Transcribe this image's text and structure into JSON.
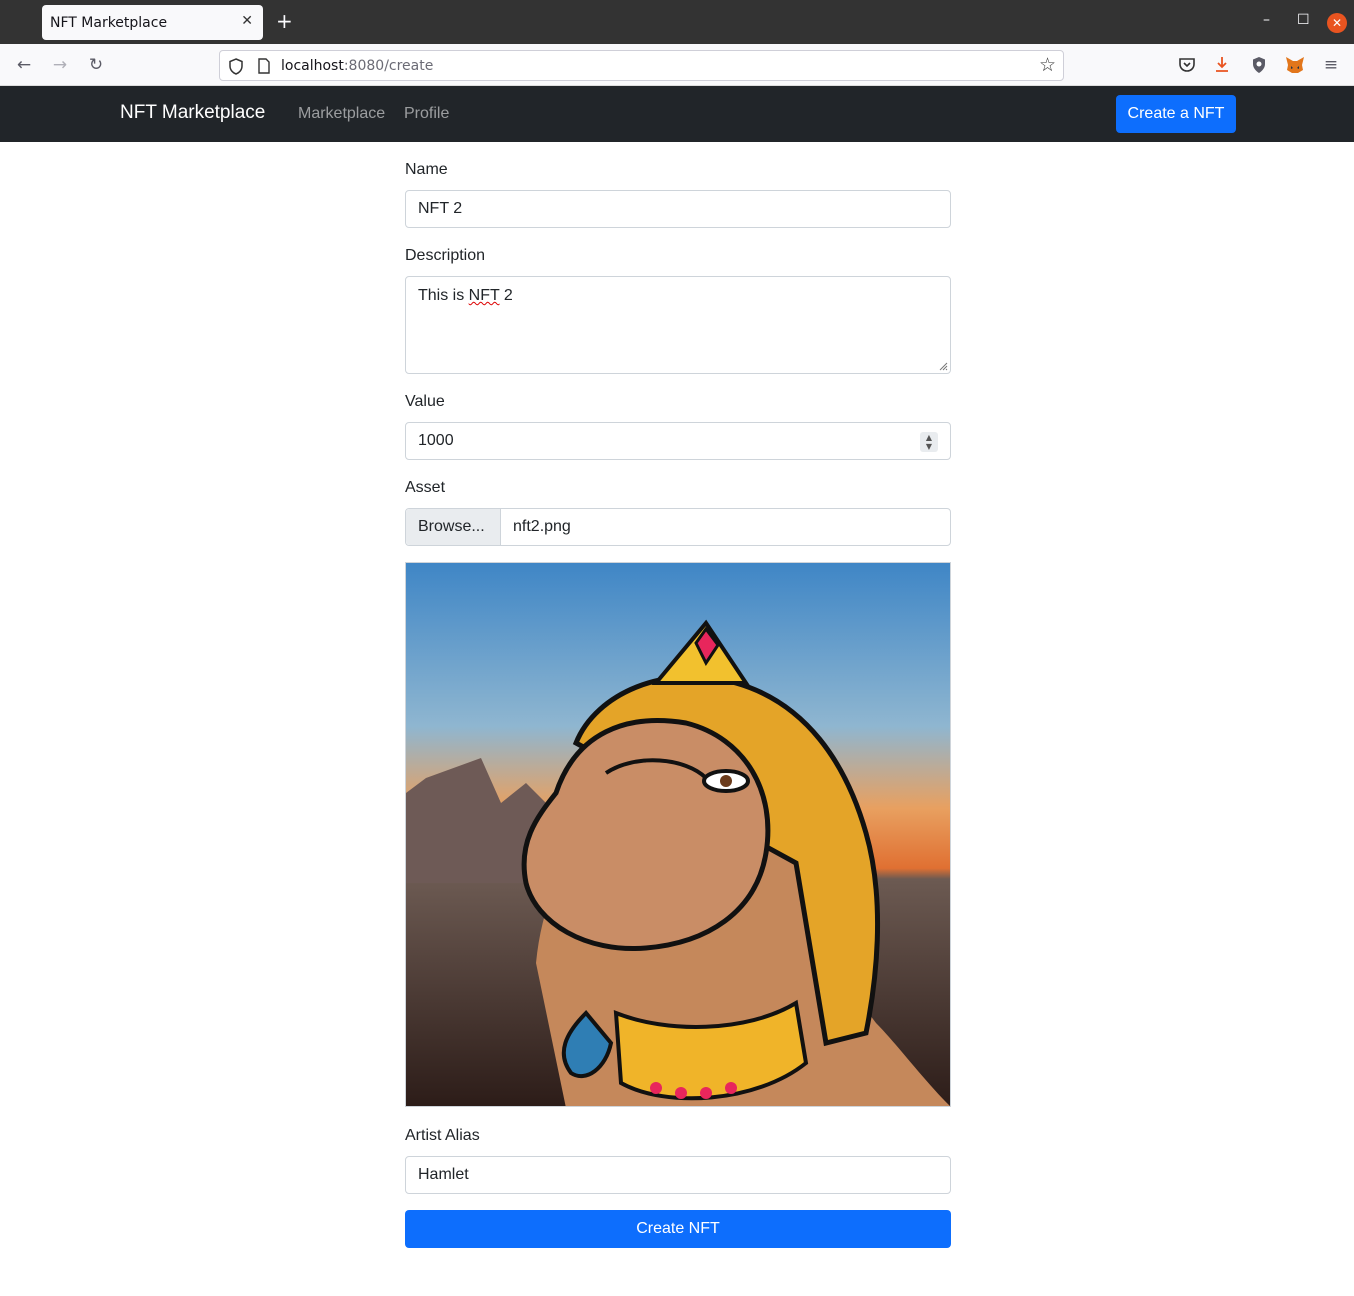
{
  "browser": {
    "tab_title": "NFT Marketplace",
    "url_host": "localhost",
    "url_rest": ":8080/create"
  },
  "app": {
    "brand": "NFT Marketplace",
    "nav": [
      "Marketplace",
      "Profile"
    ],
    "create_button": "Create a NFT"
  },
  "form": {
    "name_label": "Name",
    "name_value": "NFT 2",
    "description_label": "Description",
    "description_prefix": "This is ",
    "description_word": "NFT",
    "description_suffix": " 2",
    "value_label": "Value",
    "value_value": "1000",
    "asset_label": "Asset",
    "browse_label": "Browse...",
    "file_name": "nft2.png",
    "alias_label": "Artist Alias",
    "alias_value": "Hamlet",
    "submit_label": "Create NFT"
  },
  "icons": [
    "back-icon",
    "forward-icon",
    "reload-icon",
    "shield-icon",
    "page-icon",
    "star-icon",
    "pocket-icon",
    "download-icon",
    "extension-shield-icon",
    "metamask-fox-icon",
    "menu-icon"
  ]
}
